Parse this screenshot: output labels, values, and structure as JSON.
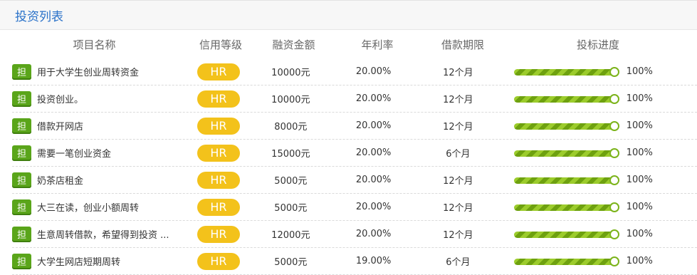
{
  "panel": {
    "title": "投资列表"
  },
  "table": {
    "headers": {
      "name": "项目名称",
      "credit": "信用等级",
      "amount": "融资金额",
      "rate": "年利率",
      "term": "借款期限",
      "progress": "投标进度"
    },
    "badge_label": "担",
    "rows": [
      {
        "name": "用于大学生创业周转资金",
        "credit": "HR",
        "amount": "10000元",
        "rate": "20.00%",
        "term": "12个月",
        "progress": 1.0,
        "progress_label": "100%"
      },
      {
        "name": "投资创业。",
        "credit": "HR",
        "amount": "10000元",
        "rate": "20.00%",
        "term": "12个月",
        "progress": 1.0,
        "progress_label": "100%"
      },
      {
        "name": "借款开网店",
        "credit": "HR",
        "amount": "8000元",
        "rate": "20.00%",
        "term": "12个月",
        "progress": 1.0,
        "progress_label": "100%"
      },
      {
        "name": "需要一笔创业资金",
        "credit": "HR",
        "amount": "15000元",
        "rate": "20.00%",
        "term": "6个月",
        "progress": 1.0,
        "progress_label": "100%"
      },
      {
        "name": "奶茶店租金",
        "credit": "HR",
        "amount": "5000元",
        "rate": "20.00%",
        "term": "12个月",
        "progress": 1.0,
        "progress_label": "100%"
      },
      {
        "name": "大三在读，创业小额周转",
        "credit": "HR",
        "amount": "5000元",
        "rate": "20.00%",
        "term": "12个月",
        "progress": 1.0,
        "progress_label": "100%"
      },
      {
        "name": "生意周转借款，希望得到投资 ...",
        "credit": "HR",
        "amount": "12000元",
        "rate": "20.00%",
        "term": "12个月",
        "progress": 1.0,
        "progress_label": "100%"
      },
      {
        "name": "大学生网店短期周转",
        "credit": "HR",
        "amount": "5000元",
        "rate": "19.00%",
        "term": "6个月",
        "progress": 1.0,
        "progress_label": "100%"
      }
    ]
  },
  "colors": {
    "title": "#2a72c9",
    "badge": "#5aa51a",
    "credit_pill": "#f3c21b",
    "progress": "#8cc322"
  }
}
